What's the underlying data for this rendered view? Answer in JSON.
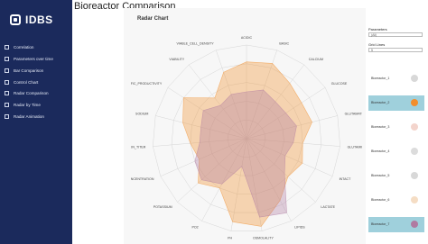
{
  "sidebar": {
    "logo_text": "IDBS",
    "items": [
      {
        "label": "Correlation"
      },
      {
        "label": "Parameters over time"
      },
      {
        "label": "Bar Comparison"
      },
      {
        "label": "Control Chart"
      },
      {
        "label": "Radar Comparison"
      },
      {
        "label": "Radar by Time"
      },
      {
        "label": "Radar Animation"
      }
    ]
  },
  "header": {
    "title": "Bioreactor Comparison"
  },
  "chart": {
    "title": "Radar Chart"
  },
  "controls": {
    "parameters_label": "Parameters",
    "parameters_value": "(All)",
    "grid_lines_label": "Grid Lines",
    "grid_lines_value": "5"
  },
  "legend": [
    {
      "label": "Bioreactor_1",
      "color": "#d8d8d8",
      "selected": false
    },
    {
      "label": "Bioreactor_2",
      "color": "#f28e2b",
      "selected": true
    },
    {
      "label": "Bioreactor_3",
      "color": "#f3d4cc",
      "selected": false
    },
    {
      "label": "Bioreactor_4",
      "color": "#dcdcdc",
      "selected": false
    },
    {
      "label": "Bioreactor_5",
      "color": "#d8d8d8",
      "selected": false
    },
    {
      "label": "Bioreactor_6",
      "color": "#f5ddc4",
      "selected": false
    },
    {
      "label": "Bioreactor_7",
      "color": "#b07aa1",
      "selected": true
    }
  ],
  "chart_data": {
    "type": "radar",
    "axes": [
      "ACIDIC",
      "BASIC",
      "CALCIUM",
      "GLUCOSE",
      "GLUTAMATE",
      "GLUTAMINE",
      "INTACT",
      "LACTATE",
      "LIPIDS",
      "OSMOLALITY",
      "PH",
      "PO2",
      "POTASSIUM",
      "PRODUCT_CONCENTRATION",
      "PROTEIN_TITER",
      "SODIUM",
      "SPECIFIC_PRODUCTIVITY",
      "VIABILITY",
      "VIABLE_CELL_DENSITY"
    ],
    "grid_levels": 5,
    "series": [
      {
        "name": "Bioreactor_2",
        "color": "#f28e2b",
        "values": [
          0.82,
          0.85,
          0.75,
          0.7,
          0.72,
          0.6,
          0.65,
          0.6,
          0.75,
          0.95,
          0.9,
          0.6,
          0.7,
          0.55,
          0.6,
          0.7,
          0.8,
          0.55,
          0.75
        ]
      },
      {
        "name": "Bioreactor_7",
        "color": "#b07aa1",
        "values": [
          0.5,
          0.55,
          0.5,
          0.5,
          0.55,
          0.5,
          0.45,
          0.55,
          0.9,
          0.85,
          0.3,
          0.55,
          0.65,
          0.6,
          0.5,
          0.5,
          0.55,
          0.45,
          0.5
        ]
      }
    ]
  }
}
